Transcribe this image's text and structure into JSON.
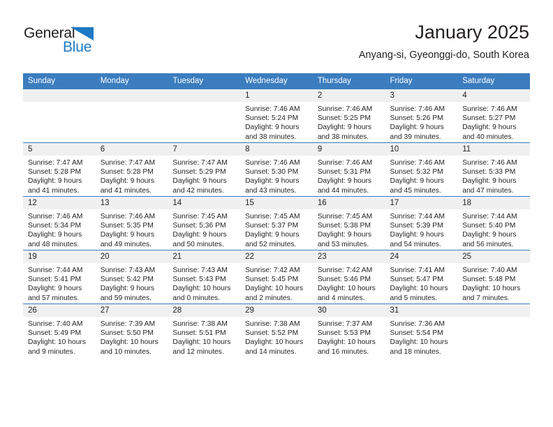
{
  "brand": {
    "name_part1": "General",
    "name_part2": "Blue",
    "triangle_color": "#1d79c4"
  },
  "header": {
    "title": "January 2025",
    "subtitle": "Anyang-si, Gyeonggi-do, South Korea"
  },
  "theme": {
    "header_blue": "#3b7dbf",
    "daynum_band": "#f0f0f0",
    "text": "#231f20"
  },
  "weekdays": [
    "Sunday",
    "Monday",
    "Tuesday",
    "Wednesday",
    "Thursday",
    "Friday",
    "Saturday"
  ],
  "weeks": [
    [
      {
        "day": "",
        "empty": true
      },
      {
        "day": "",
        "empty": true
      },
      {
        "day": "",
        "empty": true
      },
      {
        "day": "1",
        "sunrise": "Sunrise: 7:46 AM",
        "sunset": "Sunset: 5:24 PM",
        "daylight_line1": "Daylight: 9 hours",
        "daylight_line2": "and 38 minutes."
      },
      {
        "day": "2",
        "sunrise": "Sunrise: 7:46 AM",
        "sunset": "Sunset: 5:25 PM",
        "daylight_line1": "Daylight: 9 hours",
        "daylight_line2": "and 38 minutes."
      },
      {
        "day": "3",
        "sunrise": "Sunrise: 7:46 AM",
        "sunset": "Sunset: 5:26 PM",
        "daylight_line1": "Daylight: 9 hours",
        "daylight_line2": "and 39 minutes."
      },
      {
        "day": "4",
        "sunrise": "Sunrise: 7:46 AM",
        "sunset": "Sunset: 5:27 PM",
        "daylight_line1": "Daylight: 9 hours",
        "daylight_line2": "and 40 minutes."
      }
    ],
    [
      {
        "day": "5",
        "sunrise": "Sunrise: 7:47 AM",
        "sunset": "Sunset: 5:28 PM",
        "daylight_line1": "Daylight: 9 hours",
        "daylight_line2": "and 41 minutes."
      },
      {
        "day": "6",
        "sunrise": "Sunrise: 7:47 AM",
        "sunset": "Sunset: 5:28 PM",
        "daylight_line1": "Daylight: 9 hours",
        "daylight_line2": "and 41 minutes."
      },
      {
        "day": "7",
        "sunrise": "Sunrise: 7:47 AM",
        "sunset": "Sunset: 5:29 PM",
        "daylight_line1": "Daylight: 9 hours",
        "daylight_line2": "and 42 minutes."
      },
      {
        "day": "8",
        "sunrise": "Sunrise: 7:46 AM",
        "sunset": "Sunset: 5:30 PM",
        "daylight_line1": "Daylight: 9 hours",
        "daylight_line2": "and 43 minutes."
      },
      {
        "day": "9",
        "sunrise": "Sunrise: 7:46 AM",
        "sunset": "Sunset: 5:31 PM",
        "daylight_line1": "Daylight: 9 hours",
        "daylight_line2": "and 44 minutes."
      },
      {
        "day": "10",
        "sunrise": "Sunrise: 7:46 AM",
        "sunset": "Sunset: 5:32 PM",
        "daylight_line1": "Daylight: 9 hours",
        "daylight_line2": "and 45 minutes."
      },
      {
        "day": "11",
        "sunrise": "Sunrise: 7:46 AM",
        "sunset": "Sunset: 5:33 PM",
        "daylight_line1": "Daylight: 9 hours",
        "daylight_line2": "and 47 minutes."
      }
    ],
    [
      {
        "day": "12",
        "sunrise": "Sunrise: 7:46 AM",
        "sunset": "Sunset: 5:34 PM",
        "daylight_line1": "Daylight: 9 hours",
        "daylight_line2": "and 48 minutes."
      },
      {
        "day": "13",
        "sunrise": "Sunrise: 7:46 AM",
        "sunset": "Sunset: 5:35 PM",
        "daylight_line1": "Daylight: 9 hours",
        "daylight_line2": "and 49 minutes."
      },
      {
        "day": "14",
        "sunrise": "Sunrise: 7:45 AM",
        "sunset": "Sunset: 5:36 PM",
        "daylight_line1": "Daylight: 9 hours",
        "daylight_line2": "and 50 minutes."
      },
      {
        "day": "15",
        "sunrise": "Sunrise: 7:45 AM",
        "sunset": "Sunset: 5:37 PM",
        "daylight_line1": "Daylight: 9 hours",
        "daylight_line2": "and 52 minutes."
      },
      {
        "day": "16",
        "sunrise": "Sunrise: 7:45 AM",
        "sunset": "Sunset: 5:38 PM",
        "daylight_line1": "Daylight: 9 hours",
        "daylight_line2": "and 53 minutes."
      },
      {
        "day": "17",
        "sunrise": "Sunrise: 7:44 AM",
        "sunset": "Sunset: 5:39 PM",
        "daylight_line1": "Daylight: 9 hours",
        "daylight_line2": "and 54 minutes."
      },
      {
        "day": "18",
        "sunrise": "Sunrise: 7:44 AM",
        "sunset": "Sunset: 5:40 PM",
        "daylight_line1": "Daylight: 9 hours",
        "daylight_line2": "and 56 minutes."
      }
    ],
    [
      {
        "day": "19",
        "sunrise": "Sunrise: 7:44 AM",
        "sunset": "Sunset: 5:41 PM",
        "daylight_line1": "Daylight: 9 hours",
        "daylight_line2": "and 57 minutes."
      },
      {
        "day": "20",
        "sunrise": "Sunrise: 7:43 AM",
        "sunset": "Sunset: 5:42 PM",
        "daylight_line1": "Daylight: 9 hours",
        "daylight_line2": "and 59 minutes."
      },
      {
        "day": "21",
        "sunrise": "Sunrise: 7:43 AM",
        "sunset": "Sunset: 5:43 PM",
        "daylight_line1": "Daylight: 10 hours",
        "daylight_line2": "and 0 minutes."
      },
      {
        "day": "22",
        "sunrise": "Sunrise: 7:42 AM",
        "sunset": "Sunset: 5:45 PM",
        "daylight_line1": "Daylight: 10 hours",
        "daylight_line2": "and 2 minutes."
      },
      {
        "day": "23",
        "sunrise": "Sunrise: 7:42 AM",
        "sunset": "Sunset: 5:46 PM",
        "daylight_line1": "Daylight: 10 hours",
        "daylight_line2": "and 4 minutes."
      },
      {
        "day": "24",
        "sunrise": "Sunrise: 7:41 AM",
        "sunset": "Sunset: 5:47 PM",
        "daylight_line1": "Daylight: 10 hours",
        "daylight_line2": "and 5 minutes."
      },
      {
        "day": "25",
        "sunrise": "Sunrise: 7:40 AM",
        "sunset": "Sunset: 5:48 PM",
        "daylight_line1": "Daylight: 10 hours",
        "daylight_line2": "and 7 minutes."
      }
    ],
    [
      {
        "day": "26",
        "sunrise": "Sunrise: 7:40 AM",
        "sunset": "Sunset: 5:49 PM",
        "daylight_line1": "Daylight: 10 hours",
        "daylight_line2": "and 9 minutes."
      },
      {
        "day": "27",
        "sunrise": "Sunrise: 7:39 AM",
        "sunset": "Sunset: 5:50 PM",
        "daylight_line1": "Daylight: 10 hours",
        "daylight_line2": "and 10 minutes."
      },
      {
        "day": "28",
        "sunrise": "Sunrise: 7:38 AM",
        "sunset": "Sunset: 5:51 PM",
        "daylight_line1": "Daylight: 10 hours",
        "daylight_line2": "and 12 minutes."
      },
      {
        "day": "29",
        "sunrise": "Sunrise: 7:38 AM",
        "sunset": "Sunset: 5:52 PM",
        "daylight_line1": "Daylight: 10 hours",
        "daylight_line2": "and 14 minutes."
      },
      {
        "day": "30",
        "sunrise": "Sunrise: 7:37 AM",
        "sunset": "Sunset: 5:53 PM",
        "daylight_line1": "Daylight: 10 hours",
        "daylight_line2": "and 16 minutes."
      },
      {
        "day": "31",
        "sunrise": "Sunrise: 7:36 AM",
        "sunset": "Sunset: 5:54 PM",
        "daylight_line1": "Daylight: 10 hours",
        "daylight_line2": "and 18 minutes."
      },
      {
        "day": "",
        "empty": true
      }
    ]
  ]
}
